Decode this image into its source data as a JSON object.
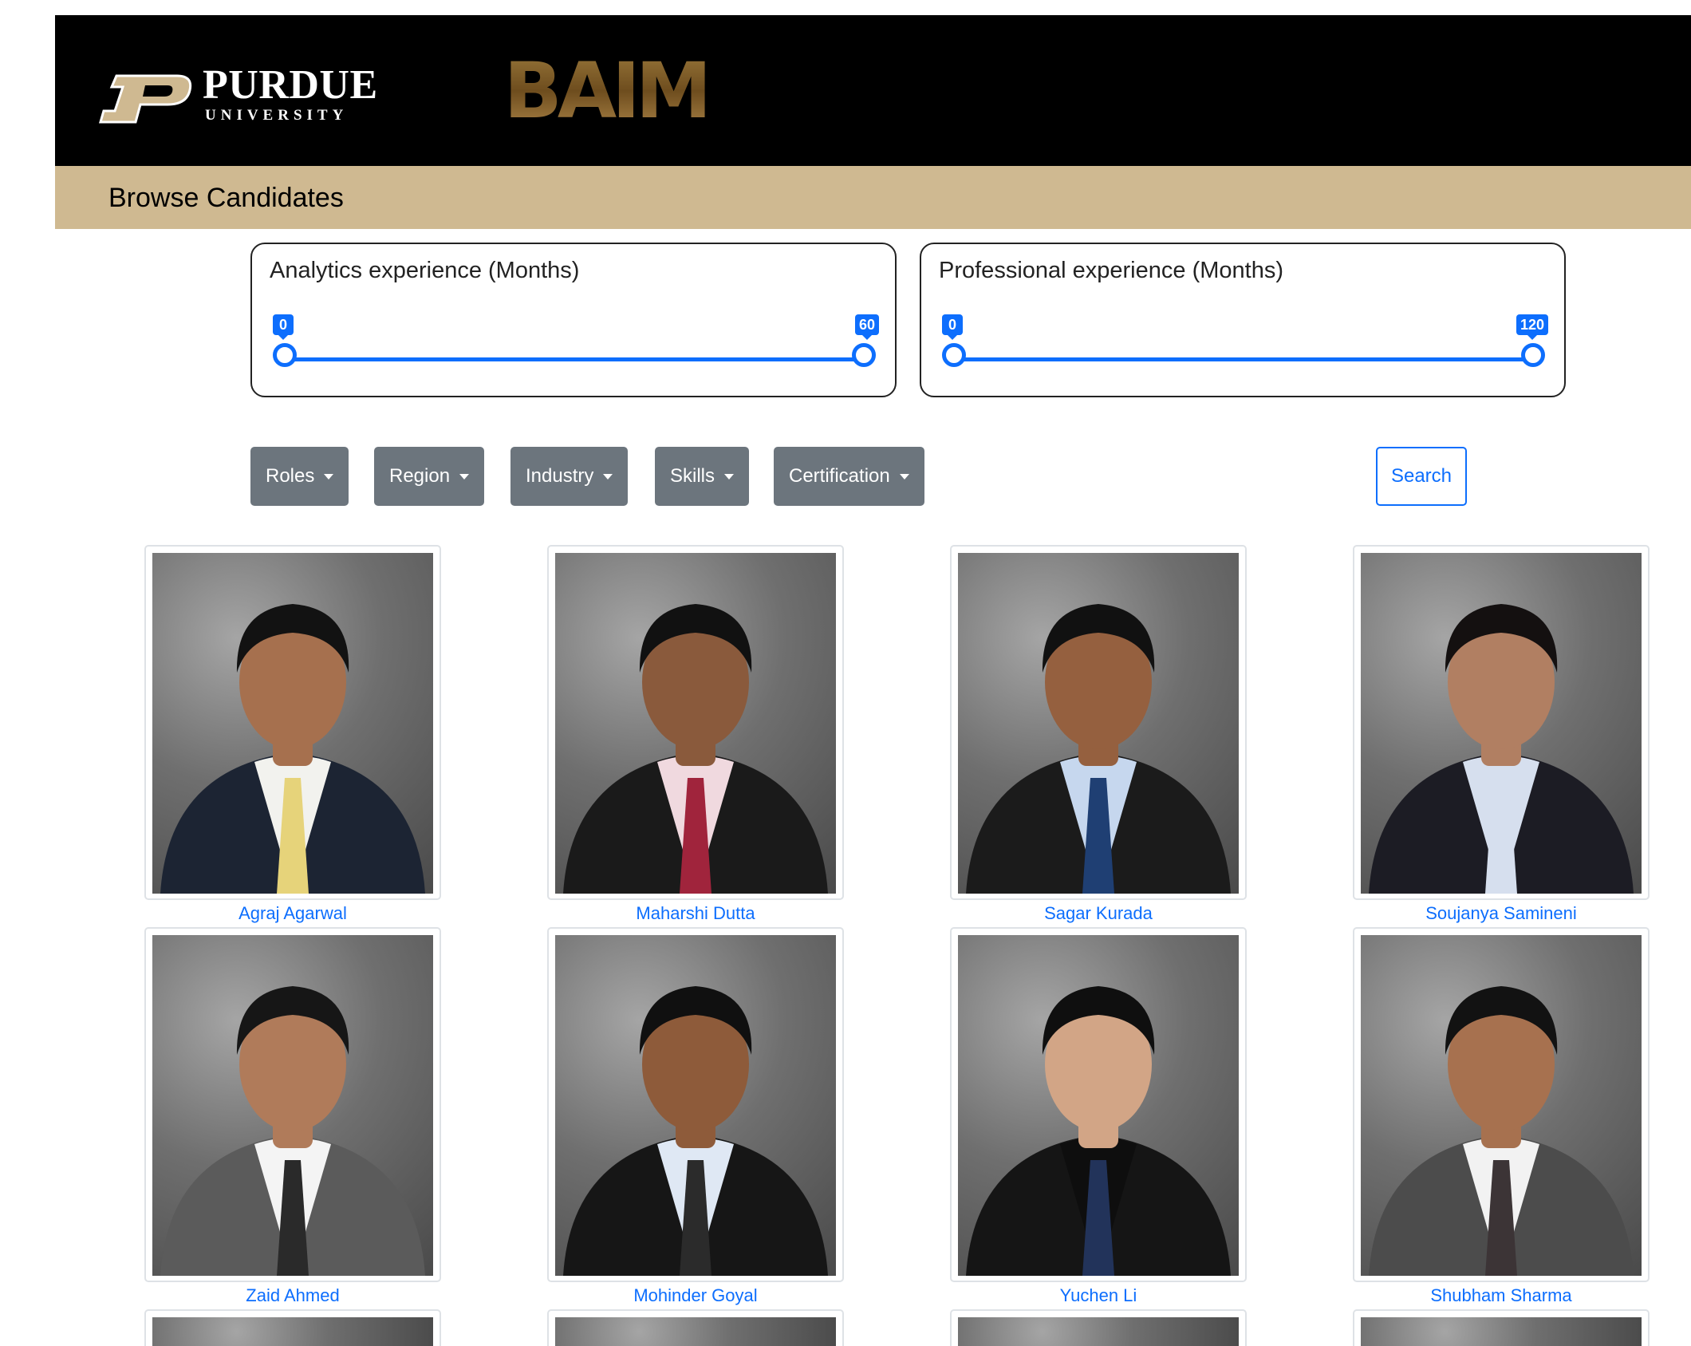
{
  "header": {
    "university_name": "PURDUE",
    "university_sub": "UNIVERSITY",
    "program_logo": "BAIM"
  },
  "page_title": "Browse Candidates",
  "ranges": [
    {
      "label": "Analytics experience (Months)",
      "min": "0",
      "max": "60"
    },
    {
      "label": "Professional experience (Months)",
      "min": "0",
      "max": "120"
    }
  ],
  "filters": [
    "Roles",
    "Region",
    "Industry",
    "Skills",
    "Certification"
  ],
  "search_label": "Search",
  "candidates": [
    {
      "name": "Agraj Agarwal",
      "suit": "#1c2433",
      "shirt": "#f2f2ee",
      "tie": "#e6d37a",
      "hair": "#121212",
      "skin": "#a6704e"
    },
    {
      "name": "Maharshi Dutta",
      "suit": "#1a1a1a",
      "shirt": "#f0d9df",
      "tie": "#a0243c",
      "hair": "#111111",
      "skin": "#8a5a3c"
    },
    {
      "name": "Sagar Kurada",
      "suit": "#1b1b1b",
      "shirt": "#c6d7ee",
      "tie": "#1f3f73",
      "hair": "#111111",
      "skin": "#95603f"
    },
    {
      "name": "Soujanya Samineni",
      "suit": "#1c1c24",
      "shirt": "#d6dfee",
      "tie": "#d6dfee",
      "hair": "#141010",
      "skin": "#b17f62"
    },
    {
      "name": "Zaid Ahmed",
      "suit": "#5b5b5b",
      "shirt": "#f4f4f4",
      "tie": "#2a2a2a",
      "hair": "#161616",
      "skin": "#b07b5a"
    },
    {
      "name": "Mohinder Goyal",
      "suit": "#161616",
      "shirt": "#dfe8f4",
      "tie": "#2b2b2b",
      "hair": "#101010",
      "skin": "#8e5b3a"
    },
    {
      "name": "Yuchen Li",
      "suit": "#151515",
      "shirt": "#0e0e0e",
      "tie": "#22335a",
      "hair": "#0f0f0f",
      "skin": "#d2a586"
    },
    {
      "name": "Shubham Sharma",
      "suit": "#4c4c4c",
      "shirt": "#f2f2f2",
      "tie": "#3c3436",
      "hair": "#121212",
      "skin": "#a7714f"
    }
  ]
}
